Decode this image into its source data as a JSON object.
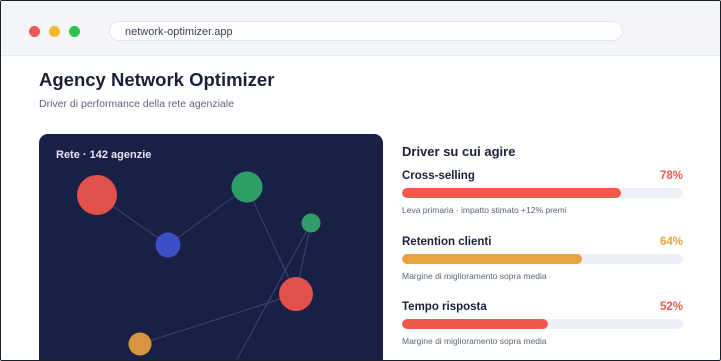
{
  "browser": {
    "url": "network-optimizer.app"
  },
  "page": {
    "title": "Agency Network Optimizer",
    "subtitle": "Driver di performance della rete agenziale"
  },
  "network": {
    "title": "Rete · 142 agenzie",
    "node_colors": [
      "#e0514a",
      "#3b4fc4",
      "#2e9d67",
      "#2e9d67",
      "#e0514a",
      "#d7953f"
    ]
  },
  "drivers": {
    "title": "Driver su cui agire",
    "items": [
      {
        "name": "Cross-selling",
        "percent_label": "78%",
        "value": 0.78,
        "color": "#f05a4c",
        "note": "Leva primaria · impatto stimato +12% premi"
      },
      {
        "name": "Retention clienti",
        "percent_label": "64%",
        "value": 0.64,
        "color": "#e7a43e",
        "note": "Margine di miglioramento sopra media"
      },
      {
        "name": "Tempo risposta",
        "percent_label": "52%",
        "value": 0.52,
        "color": "#f05a4c",
        "note": "Margine di miglioramento sopra media"
      }
    ]
  }
}
